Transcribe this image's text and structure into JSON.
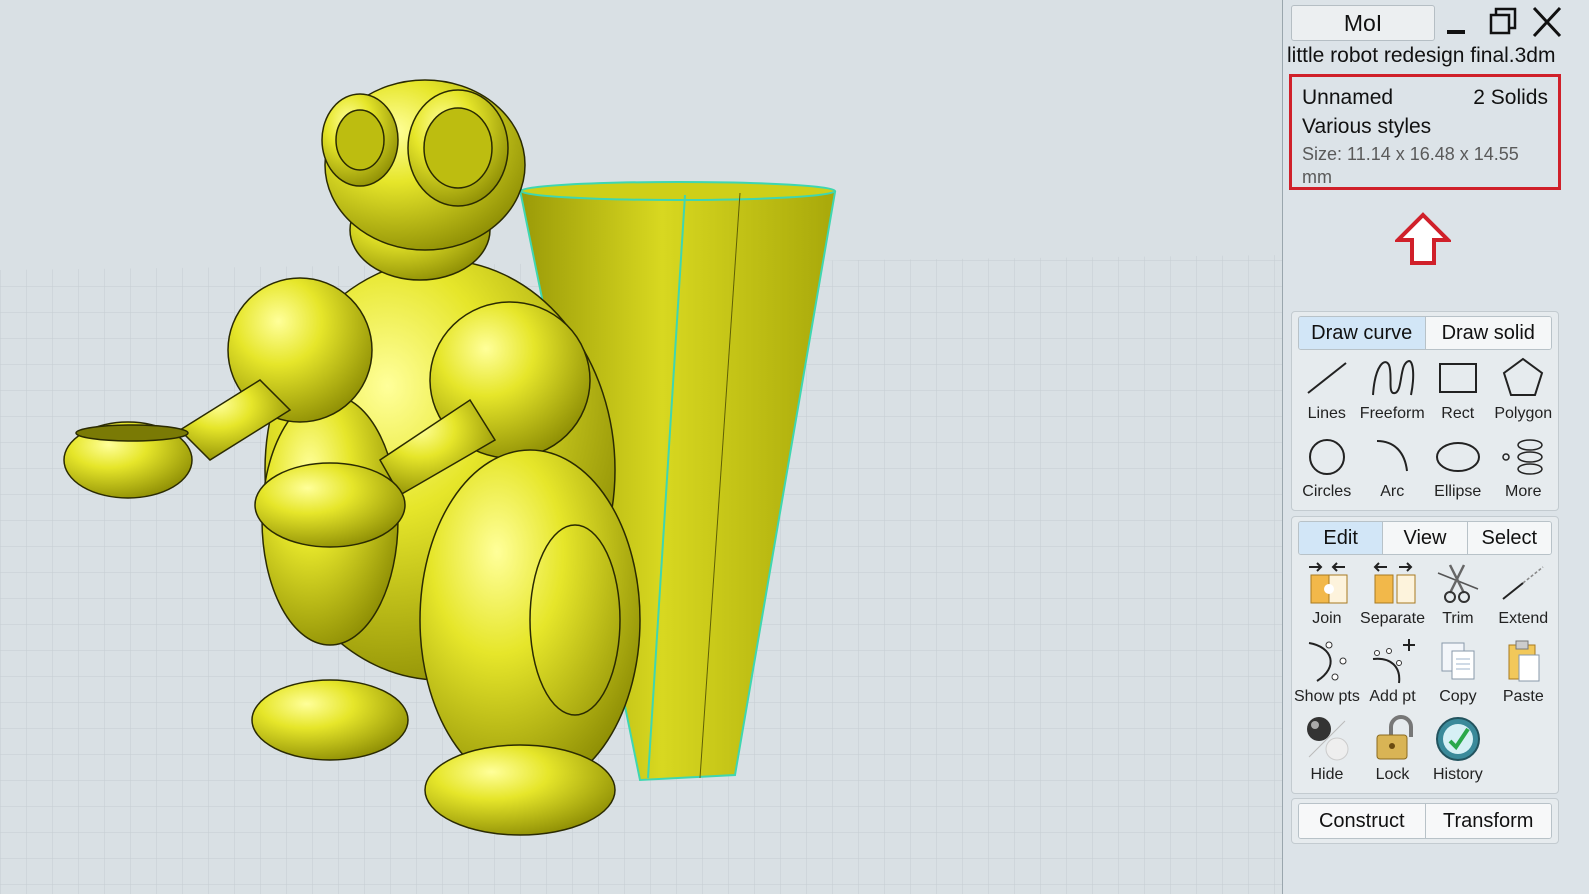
{
  "window": {
    "app_button_label": "MoI",
    "file_name": "little robot redesign final.3dm"
  },
  "properties": {
    "name": "Unnamed",
    "count": "2 Solids",
    "style": "Various styles",
    "size": "Size: 11.14 x 16.48 x 14.55 mm",
    "highlight_color": "#d0202a"
  },
  "draw_group": {
    "tabs": [
      {
        "label": "Draw curve",
        "active": true
      },
      {
        "label": "Draw solid",
        "active": false
      }
    ],
    "tools": [
      {
        "label": "Lines",
        "icon": "line-icon"
      },
      {
        "label": "Freeform",
        "icon": "freeform-curve-icon"
      },
      {
        "label": "Rect",
        "icon": "rectangle-icon"
      },
      {
        "label": "Polygon",
        "icon": "polygon-icon"
      },
      {
        "label": "Circles",
        "icon": "circle-icon"
      },
      {
        "label": "Arc",
        "icon": "arc-icon"
      },
      {
        "label": "Ellipse",
        "icon": "ellipse-icon"
      },
      {
        "label": "More",
        "icon": "helix-icon"
      }
    ]
  },
  "edit_group": {
    "tabs": [
      {
        "label": "Edit",
        "active": true
      },
      {
        "label": "View",
        "active": false
      },
      {
        "label": "Select",
        "active": false
      }
    ],
    "tools": [
      {
        "label": "Join",
        "icon": "join-icon"
      },
      {
        "label": "Separate",
        "icon": "separate-icon"
      },
      {
        "label": "Trim",
        "icon": "scissors-icon"
      },
      {
        "label": "Extend",
        "icon": "extend-icon"
      },
      {
        "label": "Show pts",
        "icon": "show-points-icon"
      },
      {
        "label": "Add pt",
        "icon": "add-point-icon"
      },
      {
        "label": "Copy",
        "icon": "copy-icon"
      },
      {
        "label": "Paste",
        "icon": "paste-icon"
      },
      {
        "label": "Hide",
        "icon": "hide-icon"
      },
      {
        "label": "Lock",
        "icon": "lock-icon"
      },
      {
        "label": "History",
        "icon": "history-icon"
      }
    ]
  },
  "bottom_tabs": [
    {
      "label": "Construct"
    },
    {
      "label": "Transform"
    }
  ],
  "model": {
    "color": "#d9d91a",
    "highlight_edge_color": "#3fd6b0"
  }
}
